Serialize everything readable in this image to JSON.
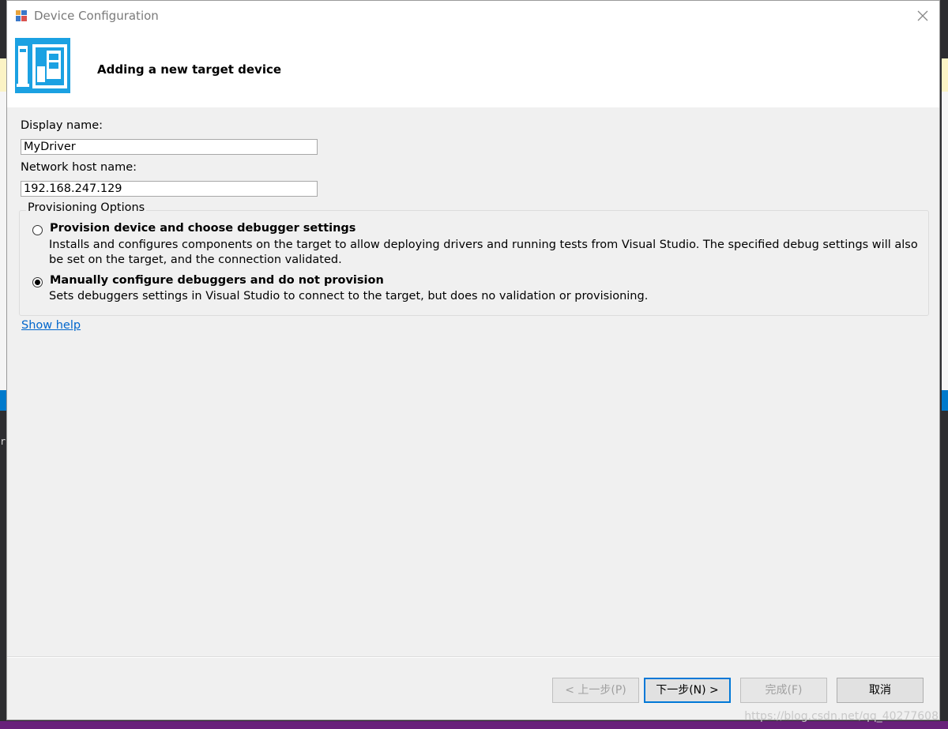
{
  "window": {
    "title": "Device Configuration",
    "close_icon": "close-icon"
  },
  "header": {
    "title": "Adding a new target device"
  },
  "form": {
    "display_name_label": "Display name:",
    "display_name_value": "MyDriver",
    "host_label": "Network host name:",
    "host_value": "192.168.247.129"
  },
  "provisioning": {
    "legend": "Provisioning Options",
    "options": [
      {
        "title": "Provision device and choose debugger settings",
        "description_line1": "Installs and configures components on the target to allow deploying drivers and running tests from Visual Studio. The specified debug settings will also",
        "description_line2": "be set on the target, and the connection validated.",
        "selected": false
      },
      {
        "title": "Manually configure debuggers and do not provision",
        "description_line1": "Sets debuggers settings in Visual Studio to connect to the target, but does no validation or provisioning.",
        "selected": true
      }
    ]
  },
  "help_link": "Show help",
  "buttons": {
    "back": "< 上一步(P)",
    "next": "下一步(N) >",
    "finish": "完成(F)",
    "cancel": "取消"
  },
  "background": {
    "char": "r"
  },
  "watermark": "https://blog.csdn.net/qq_40277608",
  "colors": {
    "accent": "#1ba1e2",
    "link": "#0066cc",
    "default_button_border": "#0078d7"
  }
}
